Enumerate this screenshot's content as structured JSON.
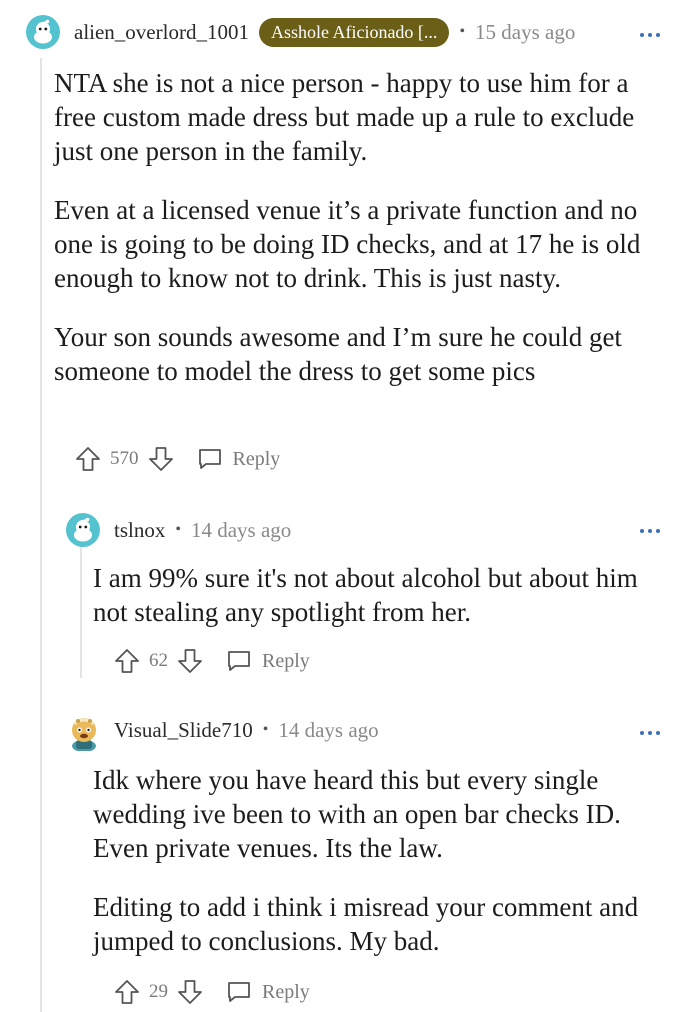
{
  "comments": [
    {
      "username": "alien_overlord_1001",
      "flair": "Asshole Aficionado [...",
      "separator": "•",
      "time": "15 days ago",
      "paragraphs": [
        "NTA she is not a nice person - happy to use him for a free custom made dress but made up a rule to exclude just one person in the family.",
        "Even at a licensed venue it’s a private function and no one is going to be doing ID checks, and at 17 he is old enough to know not to drink. This is just nasty.",
        "Your son sounds awesome and I’m sure he could get someone to model the dress to get some pics"
      ],
      "votes": "570",
      "reply_label": "Reply"
    },
    {
      "username": "tslnox",
      "separator": "•",
      "time": "14 days ago",
      "paragraphs": [
        "I am 99% sure it's not about alcohol but about him not stealing any spotlight from her."
      ],
      "votes": "62",
      "reply_label": "Reply"
    },
    {
      "username": "Visual_Slide710",
      "separator": "•",
      "time": "14 days ago",
      "paragraphs": [
        "Idk where you have heard this but every single wedding ive been to with an open bar checks ID. Even private venues. Its the law.",
        "Editing to add i think i misread your comment and jumped to conclusions. My bad."
      ],
      "votes": "29",
      "reply_label": "Reply"
    }
  ],
  "colors": {
    "flair_bg": "#6b5f18",
    "avatar_teal": "#54c2cf",
    "link_blue": "#3d6fb8",
    "muted": "#7a7a7a"
  },
  "icons": [
    "reddit-avatar-icon",
    "cartoon-avatar-icon",
    "more-options-icon",
    "upvote-arrow-icon",
    "downvote-arrow-icon",
    "reply-bubble-icon"
  ]
}
